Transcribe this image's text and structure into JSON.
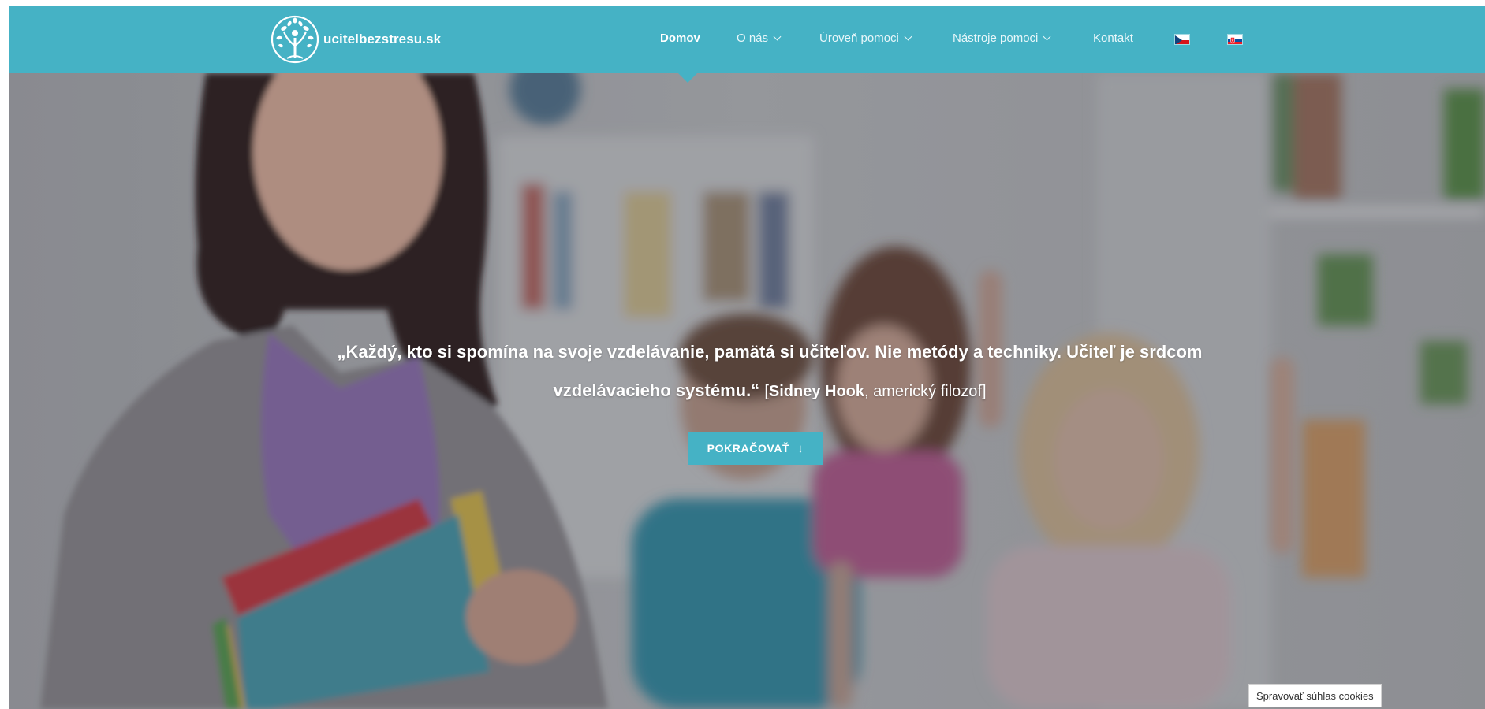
{
  "site": {
    "logo_text": "ucitelbezstresu.sk",
    "brand_color": "#45b2c5"
  },
  "nav": {
    "items": [
      {
        "label": "Domov",
        "active": true,
        "has_dropdown": false
      },
      {
        "label": "O nás",
        "active": false,
        "has_dropdown": true
      },
      {
        "label": "Úroveň pomoci",
        "active": false,
        "has_dropdown": true
      },
      {
        "label": "Nástroje pomoci",
        "active": false,
        "has_dropdown": true
      },
      {
        "label": "Kontakt",
        "active": false,
        "has_dropdown": false
      }
    ],
    "languages": [
      {
        "code": "cs",
        "icon": "czech-flag-icon"
      },
      {
        "code": "sk",
        "icon": "slovak-flag-icon"
      }
    ]
  },
  "hero": {
    "quote_text": "„Každý, kto si spomína na svoje vzdelávanie, pamätá si učiteľov. Nie metódy a techniky. Učiteľ je srdcom vzdelávacieho systému.“",
    "attribution_open": "[",
    "attribution_name": "Sidney Hook",
    "attribution_role": ", americký filozof]",
    "cta_label": "POKRAČOVAŤ",
    "cta_icon": "arrow-down-icon"
  },
  "cookies": {
    "button_label": "Spravovať súhlas cookies"
  }
}
